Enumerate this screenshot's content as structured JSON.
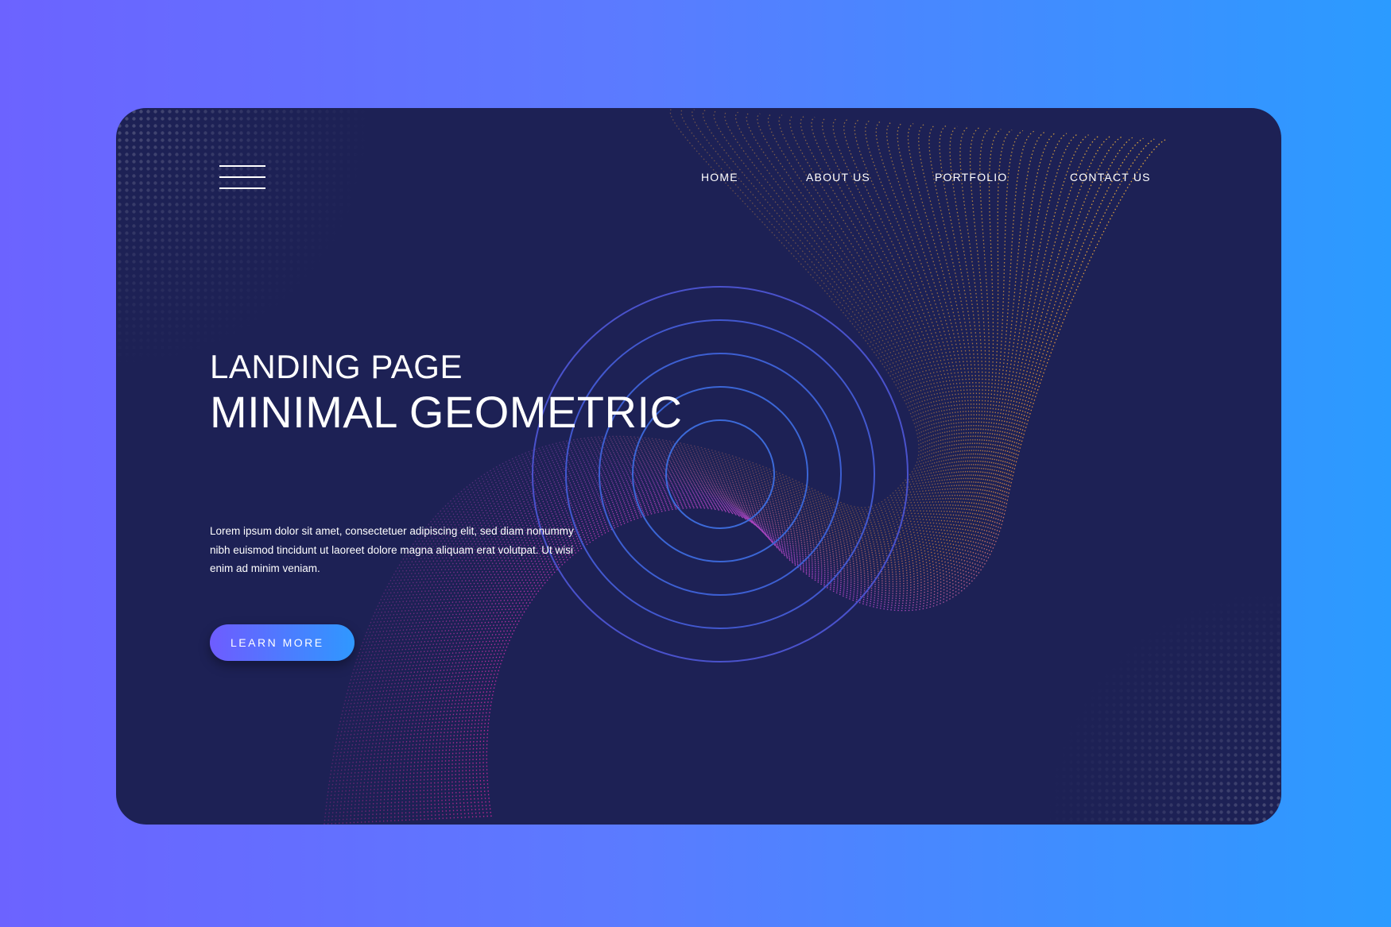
{
  "navigation": {
    "menu_icon": "hamburger-menu-icon",
    "items": [
      {
        "label": "HOME"
      },
      {
        "label": "ABOUT US"
      },
      {
        "label": "PORTFOLIO"
      },
      {
        "label": "CONTACT US"
      }
    ]
  },
  "hero": {
    "title_line_1": "LANDING PAGE",
    "title_line_2": "MINIMAL GEOMETRIC",
    "description": "Lorem ipsum dolor sit amet, consectetuer adipiscing elit, sed diam nonummy nibh euismod tincidunt ut laoreet dolore magna aliquam erat volutpat. Ut wisi enim ad minim veniam.",
    "cta_label": "LEARN MORE"
  },
  "colors": {
    "page_gradient_start": "#6c63ff",
    "page_gradient_end": "#2b9bff",
    "card_background": "#1d2155",
    "wave_orange": "#f0a03a",
    "wave_magenta": "#d4279b",
    "rings_blue": "#3d63d8",
    "halftone_blue": "#3c5fd0",
    "button_gradient_start": "#6e5cff",
    "button_gradient_end": "#2f98ff"
  }
}
